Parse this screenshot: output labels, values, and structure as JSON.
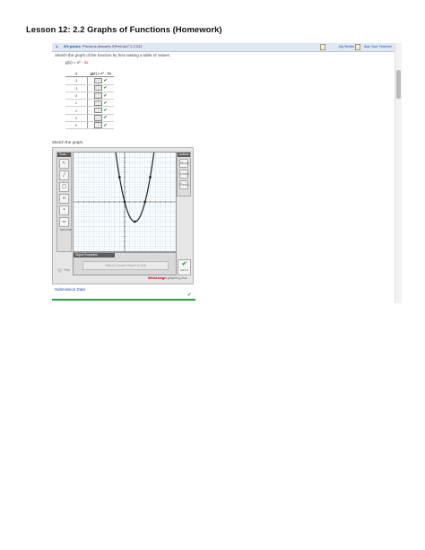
{
  "page": {
    "title": "Lesson 12: 2.2 Graphs of Functions (Homework)"
  },
  "question": {
    "number": "1.",
    "points": "3/3 points",
    "previous_answers": "Previous Answers SPreCalc7 2.2.012",
    "my_notes": "My Notes",
    "ask_teacher": "Ask Your Teacher",
    "prompt": "Sketch the graph of the function by first making a table of values.",
    "function_label": "g(x) = x²",
    "function_extra": "- 4x",
    "table": {
      "headers": [
        "x",
        "g(x) = x² - 4x"
      ],
      "rows": [
        {
          "x": "-1"
        },
        {
          "x": "-1"
        },
        {
          "x": "0"
        },
        {
          "x": "2"
        },
        {
          "x": "4"
        },
        {
          "x": "5"
        },
        {
          "x": "6"
        }
      ]
    },
    "sketch_label": "Sketch the graph.",
    "submit_answer": "Submission Data"
  },
  "tool": {
    "tools_title": "Tools",
    "actions_title": "Actions",
    "tool_buttons": [
      "↖",
      "╱",
      "◯",
      "∪",
      "•",
      "NO SOLUTION"
    ],
    "action_buttons": [
      "Move",
      "Undo",
      "Redo"
    ],
    "properties_title": "Object Properties",
    "properties_message": "Select a Graph Object to Edit",
    "help": "Help",
    "submit": "Submit",
    "brand_prefix": "WebAssign",
    "brand_suffix": " graphing tool"
  },
  "colors": {
    "accent": "#1a4ea8",
    "check": "#2ea043",
    "red": "#c0392b"
  },
  "chart_data": {
    "type": "line",
    "function": "g(x) = x^2 - 4x",
    "points": [
      [
        -1,
        5
      ],
      [
        0,
        0
      ],
      [
        2,
        -4
      ],
      [
        4,
        0
      ],
      [
        5,
        5
      ]
    ],
    "xlim": [
      -10,
      10
    ],
    "ylim": [
      -10,
      10
    ],
    "grid": true
  }
}
